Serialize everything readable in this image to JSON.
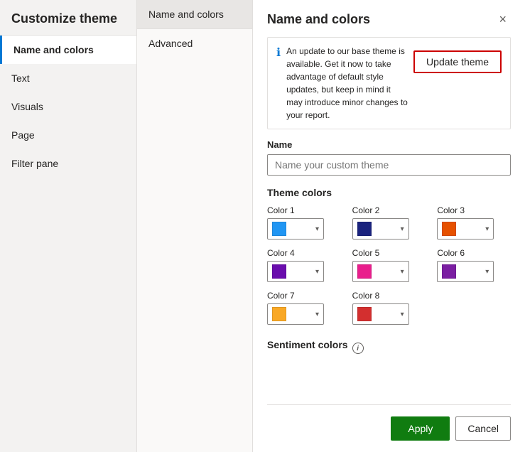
{
  "sidebar": {
    "title": "Customize theme",
    "items": [
      {
        "id": "name-and-colors",
        "label": "Name and colors",
        "active": true
      },
      {
        "id": "text",
        "label": "Text",
        "active": false
      },
      {
        "id": "visuals",
        "label": "Visuals",
        "active": false
      },
      {
        "id": "page",
        "label": "Page",
        "active": false
      },
      {
        "id": "filter-pane",
        "label": "Filter pane",
        "active": false
      }
    ]
  },
  "center_panel": {
    "tabs": [
      {
        "id": "name-colors-tab",
        "label": "Name and colors",
        "active": true
      },
      {
        "id": "advanced-tab",
        "label": "Advanced",
        "active": false
      }
    ]
  },
  "right_panel": {
    "title": "Name and colors",
    "close_label": "×",
    "info_text": "An update to our base theme is available. Get it now to take advantage of default style updates, but keep in mind it may introduce minor changes to your report.",
    "update_theme_label": "Update theme",
    "name_field": {
      "label": "Name",
      "placeholder": "Name your custom theme",
      "value": ""
    },
    "theme_colors_title": "Theme colors",
    "colors": [
      {
        "id": "color1",
        "label": "Color 1",
        "hex": "#2196F3"
      },
      {
        "id": "color2",
        "label": "Color 2",
        "hex": "#1A237E"
      },
      {
        "id": "color3",
        "label": "Color 3",
        "hex": "#E65100"
      },
      {
        "id": "color4",
        "label": "Color 4",
        "hex": "#6A0DAD"
      },
      {
        "id": "color5",
        "label": "Color 5",
        "hex": "#E91E8C"
      },
      {
        "id": "color6",
        "label": "Color 6",
        "hex": "#7B1FA2"
      },
      {
        "id": "color7",
        "label": "Color 7",
        "hex": "#F9A825"
      },
      {
        "id": "color8",
        "label": "Color 8",
        "hex": "#D32F2F"
      }
    ],
    "sentiment_colors_title": "Sentiment colors",
    "apply_label": "Apply",
    "cancel_label": "Cancel"
  }
}
